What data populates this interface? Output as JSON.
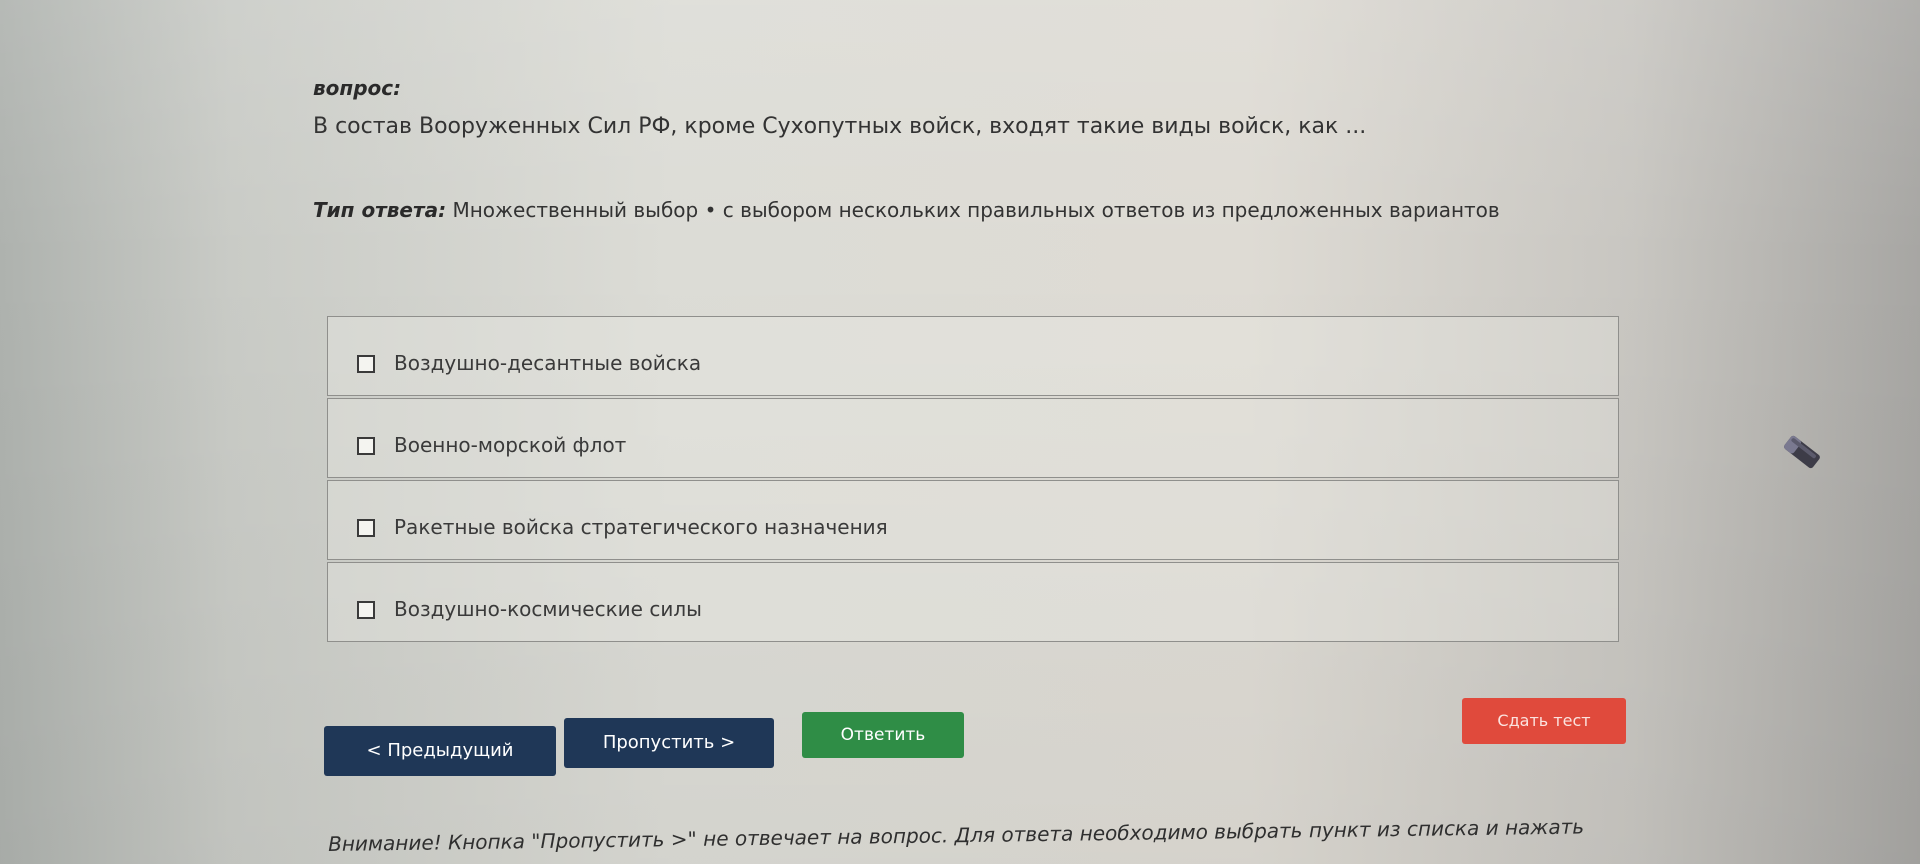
{
  "question": {
    "label": "вопрос:",
    "text": "В состав Вооруженных Сил РФ, кроме Сухопутных войск, входят такие виды войск, как ..."
  },
  "answer_type": {
    "label": "Тип ответа:",
    "value": "Множественный выбор • с выбором нескольких правильных ответов из предложенных вариантов"
  },
  "options": [
    {
      "label": "Воздушно-десантные войска",
      "checked": false
    },
    {
      "label": "Военно-морской флот",
      "checked": false
    },
    {
      "label": "Ракетные войска стратегического назначения",
      "checked": false
    },
    {
      "label": "Воздушно-космические силы",
      "checked": false
    }
  ],
  "buttons": {
    "prev": "< Предыдущий",
    "skip": "Пропустить >",
    "answer": "Ответить",
    "submit": "Сдать тест"
  },
  "note": "Внимание! Кнопка \"Пропустить >\" не отвечает на вопрос. Для ответа необходимо выбрать пункт из списка и нажать",
  "colors": {
    "nav_button": "#1f3757",
    "answer_button": "#2f8d46",
    "submit_button": "#e04a3c"
  },
  "icons": {
    "floating": "eraser-icon"
  }
}
